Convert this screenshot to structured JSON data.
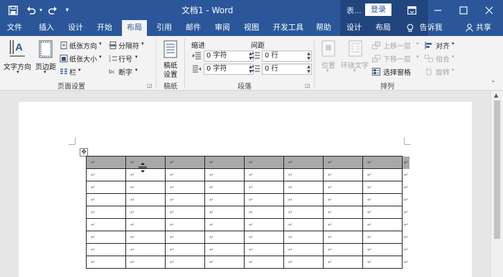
{
  "titlebar": {
    "doc_title": "文档1 - Word",
    "context_label": "表...",
    "login_label": "登录",
    "icons": [
      "save-icon",
      "undo-icon",
      "redo-icon",
      "customize-icon",
      "ribbon-display-icon",
      "minimize-icon",
      "maximize-icon",
      "close-icon"
    ]
  },
  "tabs": [
    "文件",
    "插入",
    "设计",
    "开始",
    "布局",
    "引用",
    "邮件",
    "审阅",
    "视图",
    "开发工具",
    "帮助",
    "设计",
    "布局"
  ],
  "active_tab": "布局",
  "tell_me": "告诉我",
  "share": "共享",
  "ribbon": {
    "page_setup": {
      "text_direction": "文字方向",
      "margins": "页边距",
      "orientation": "纸张方向",
      "size": "纸张大小",
      "columns": "栏",
      "breaks": "分隔符",
      "line_numbers": "行号",
      "hyphenation": "断字",
      "label": "页面设置"
    },
    "manuscript": {
      "line1": "稿纸",
      "line2": "设置",
      "label": "稿纸"
    },
    "paragraph": {
      "indent_title": "缩进",
      "spacing_title": "间距",
      "indent_left": "0 字符",
      "indent_right": "0 字符",
      "space_before": "0 行",
      "space_after": "0 行",
      "label": "段落"
    },
    "arrange": {
      "position": "位置",
      "wrap_text": "环绕文字",
      "bring_forward": "上移一层",
      "send_backward": "下移一层",
      "selection_pane": "选择窗格",
      "align": "对齐",
      "group": "组合",
      "rotate": "旋转",
      "label": "排列"
    }
  },
  "table": {
    "cols": 8,
    "rows": 9,
    "cell_mark": "↵",
    "selected_row": 0
  },
  "colors": {
    "brand": "#2b579a",
    "context": "#21467e",
    "ribbon": "#f3f3f3"
  }
}
